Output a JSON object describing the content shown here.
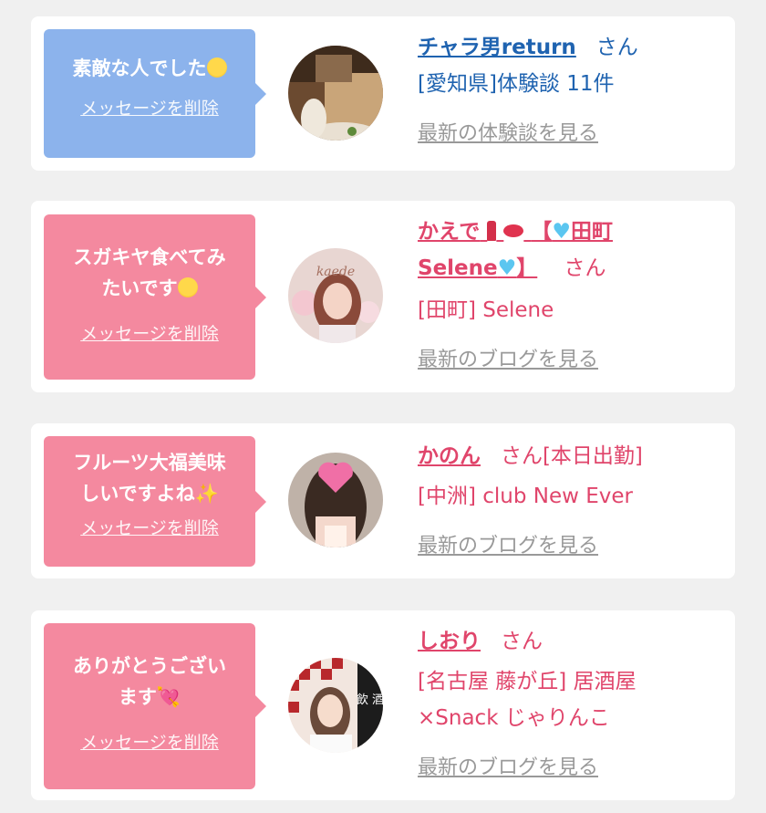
{
  "cards": [
    {
      "message": "素敵な人でした",
      "delete_label": "メッセージを削除",
      "name": "チャラ男return",
      "suffix": "さん",
      "detail1": "[愛知県]体験談 11件",
      "detail2": "",
      "latest_label": "最新の体験談を見る"
    },
    {
      "message_line1": "スガキヤ食べてみ",
      "message_line2": "たいです",
      "delete_label": "メッセージを削除",
      "name_line1": "かえで",
      "name_bracket": "【",
      "name_place": "田町",
      "name_line2": "Selene",
      "name_end": "】",
      "suffix": "さん",
      "detail1": "[田町] Selene",
      "latest_label": "最新のブログを見る"
    },
    {
      "message_line1": "フルーツ大福美味",
      "message_line2": "しいですよね",
      "delete_label": "メッセージを削除",
      "name": "かのん",
      "suffix": "さん[本日出勤]",
      "detail1": "[中洲] club New Ever",
      "latest_label": "最新のブログを見る"
    },
    {
      "message_line1": "ありがとうござい",
      "message_line2": "ます",
      "delete_label": "メッセージを削除",
      "name": "しおり",
      "suffix": "さん",
      "detail1": "[名古屋 藤が丘] 居酒屋",
      "detail2": "×Snack じゃりんこ",
      "latest_label": "最新のブログを見る"
    }
  ],
  "avatar2_text": "kaede",
  "avatar4_text": "飲 酒",
  "colors": {
    "blue_bubble": "#8cb3ec",
    "pink_bubble": "#f4899f",
    "blue_name": "#1f63b0",
    "pink_name": "#e0456b"
  }
}
